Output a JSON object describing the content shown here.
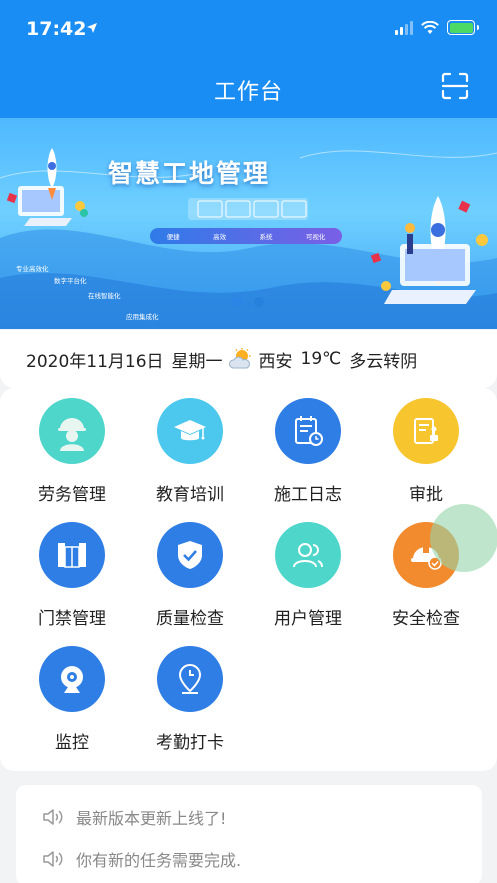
{
  "status_bar": {
    "time": "17:42"
  },
  "header": {
    "title": "工作台",
    "scan_icon": "scan-frame-icon"
  },
  "banner": {
    "title": "智慧工地管理",
    "pill_items": [
      "便捷",
      "高效",
      "系统",
      "可视化"
    ],
    "side_tags": [
      "专业高效化",
      "数字平台化",
      "在线智能化",
      "应用集成化"
    ],
    "page_count": 2,
    "active_page": 1
  },
  "weather": {
    "date": "2020年11月16日",
    "weekday": "星期一",
    "city": "西安",
    "temperature": "19℃",
    "condition": "多云转阴",
    "icon": "partly-cloudy-icon"
  },
  "apps": [
    {
      "label": "劳务管理",
      "icon": "worker-helmet-icon",
      "color": "#4fd6cb"
    },
    {
      "label": "教育培训",
      "icon": "graduation-cap-icon",
      "color": "#4cc7ee"
    },
    {
      "label": "施工日志",
      "icon": "calendar-log-icon",
      "color": "#2f7ee6"
    },
    {
      "label": "审批",
      "icon": "approval-stamp-icon",
      "color": "#f7c52d"
    },
    {
      "label": "门禁管理",
      "icon": "gate-icon",
      "color": "#2f7ee6"
    },
    {
      "label": "质量检查",
      "icon": "shield-check-icon",
      "color": "#2f7ee6"
    },
    {
      "label": "用户管理",
      "icon": "users-icon",
      "color": "#4fd6cb"
    },
    {
      "label": "安全检查",
      "icon": "safety-helmet-icon",
      "color": "#f28a2e"
    },
    {
      "label": "监控",
      "icon": "webcam-icon",
      "color": "#2f7ee6"
    },
    {
      "label": "考勤打卡",
      "icon": "clock-pin-icon",
      "color": "#2f7ee6"
    }
  ],
  "notices": [
    {
      "text": "最新版本更新上线了!",
      "icon": "speaker-icon"
    },
    {
      "text": "你有新的任务需要完成.",
      "icon": "speaker-icon"
    }
  ]
}
